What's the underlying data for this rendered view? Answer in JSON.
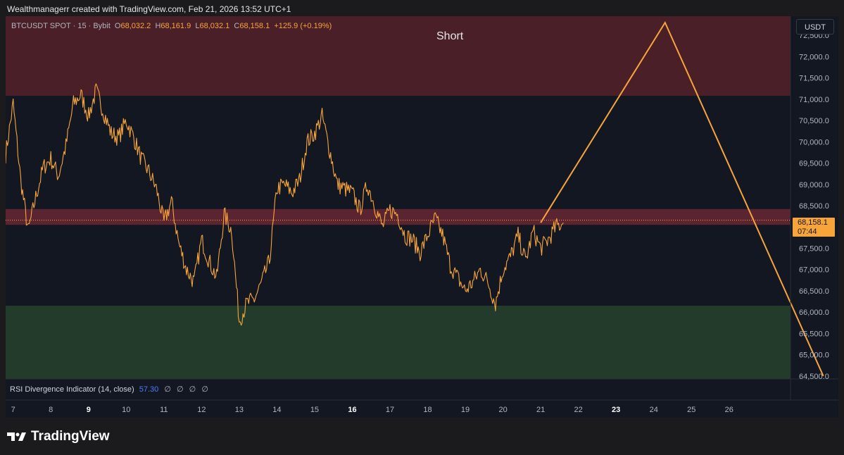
{
  "header": {
    "attribution": "Wealthmanagerr created with TradingView.com, Feb 21, 2026 13:52 UTC+1"
  },
  "legend": {
    "symbol": "BTCUSDT SPOT · 15 · Bybit",
    "open_label": "O",
    "open": "68,032.2",
    "high_label": "H",
    "high": "68,161.9",
    "low_label": "L",
    "low": "68,032.1",
    "close_label": "C",
    "close": "68,158.1",
    "change": "+125.9 (+0.19%)"
  },
  "annotation": {
    "text": "Short"
  },
  "price_scale": {
    "currency": "USDT",
    "last_price": "68,158.1",
    "countdown": "07:44"
  },
  "indicator": {
    "name": "RSI Divergence Indicator (14, close)",
    "value": "57.30",
    "na_values": [
      "∅",
      "∅",
      "∅",
      "∅"
    ]
  },
  "branding": {
    "logo_text": "TradingView"
  },
  "colors": {
    "background": "#131722",
    "candle": "#f7a53b",
    "projection": "#f7a53b",
    "supply_zone": "#4a1f28",
    "resistance_zone": "#5a2530",
    "demand_zone": "#233b2b",
    "rsi_value": "#4a7dfa"
  },
  "chart_data": {
    "type": "line",
    "title": "BTCUSDT SPOT · 15 · Bybit",
    "x_ticks": [
      {
        "label": "7",
        "day": 7,
        "bold": false
      },
      {
        "label": "8",
        "day": 8,
        "bold": false
      },
      {
        "label": "9",
        "day": 9,
        "bold": true
      },
      {
        "label": "10",
        "day": 10,
        "bold": false
      },
      {
        "label": "11",
        "day": 11,
        "bold": false
      },
      {
        "label": "12",
        "day": 12,
        "bold": false
      },
      {
        "label": "13",
        "day": 13,
        "bold": false
      },
      {
        "label": "14",
        "day": 14,
        "bold": false
      },
      {
        "label": "15",
        "day": 15,
        "bold": false
      },
      {
        "label": "16",
        "day": 16,
        "bold": true
      },
      {
        "label": "17",
        "day": 17,
        "bold": false
      },
      {
        "label": "18",
        "day": 18,
        "bold": false
      },
      {
        "label": "19",
        "day": 19,
        "bold": false
      },
      {
        "label": "20",
        "day": 20,
        "bold": false
      },
      {
        "label": "21",
        "day": 21,
        "bold": false
      },
      {
        "label": "22",
        "day": 22,
        "bold": false
      },
      {
        "label": "23",
        "day": 23,
        "bold": true
      },
      {
        "label": "24",
        "day": 24,
        "bold": false
      },
      {
        "label": "25",
        "day": 25,
        "bold": false
      },
      {
        "label": "26",
        "day": 26,
        "bold": false
      }
    ],
    "y_ticks": [
      "72,500.0",
      "72,000.0",
      "71,500.0",
      "71,000.0",
      "70,500.0",
      "70,000.0",
      "69,500.0",
      "69,000.0",
      "68,500.0",
      "67,500.0",
      "67,000.0",
      "66,500.0",
      "66,000.0",
      "65,500.0",
      "65,000.0",
      "64,500.0"
    ],
    "y_tick_values": [
      72500,
      72000,
      71500,
      71000,
      70500,
      70000,
      69500,
      69000,
      68500,
      67500,
      67000,
      66500,
      66000,
      65500,
      65000,
      64500
    ],
    "xlim": [
      6.8,
      28.9
    ],
    "ylim": [
      64430,
      72950
    ],
    "zones": [
      {
        "name": "supply",
        "from": 71080,
        "to": 72950
      },
      {
        "name": "resistance",
        "from": 68050,
        "to": 68420
      },
      {
        "name": "demand",
        "from": 64430,
        "to": 66150
      }
    ],
    "series": [
      {
        "name": "BTCUSDT",
        "x": [
          6.8,
          7.0,
          7.2,
          7.4,
          7.6,
          7.8,
          8.0,
          8.2,
          8.4,
          8.6,
          8.8,
          9.0,
          9.2,
          9.4,
          9.6,
          9.8,
          10.0,
          10.2,
          10.4,
          10.6,
          10.8,
          11.0,
          11.2,
          11.4,
          11.6,
          11.8,
          12.0,
          12.2,
          12.4,
          12.6,
          12.8,
          13.0,
          13.2,
          13.4,
          13.6,
          13.8,
          14.0,
          14.2,
          14.4,
          14.6,
          14.8,
          15.0,
          15.2,
          15.4,
          15.6,
          15.8,
          16.0,
          16.2,
          16.4,
          16.6,
          16.8,
          17.0,
          17.2,
          17.4,
          17.6,
          17.8,
          18.0,
          18.2,
          18.4,
          18.6,
          18.8,
          19.0,
          19.2,
          19.4,
          19.6,
          19.8,
          20.0,
          20.2,
          20.4,
          20.6,
          20.8,
          21.0,
          21.2,
          21.4,
          21.6
        ],
        "y": [
          69700,
          70900,
          69100,
          67900,
          68700,
          69400,
          69600,
          69200,
          69900,
          70900,
          71100,
          70600,
          71200,
          70700,
          70200,
          70100,
          70500,
          70100,
          69600,
          69300,
          68900,
          68100,
          68600,
          67600,
          67000,
          66700,
          67700,
          67200,
          66800,
          68300,
          67900,
          65800,
          66200,
          66300,
          66700,
          67200,
          68900,
          69000,
          68800,
          69100,
          70000,
          70200,
          70600,
          69800,
          69000,
          68900,
          68800,
          68400,
          69000,
          68500,
          68000,
          68400,
          68300,
          67800,
          67700,
          67400,
          67800,
          68200,
          67800,
          67100,
          66800,
          66500,
          66700,
          67000,
          66700,
          66200,
          67000,
          67300,
          67800,
          67200,
          67900,
          67500,
          67700,
          68000,
          68100
        ]
      },
      {
        "name": "projection",
        "x": [
          21.0,
          24.3,
          28.5
        ],
        "y": [
          68100,
          72800,
          64500
        ]
      }
    ],
    "last_price": 68158.1,
    "xlabel": "",
    "ylabel": "",
    "grid": false
  }
}
